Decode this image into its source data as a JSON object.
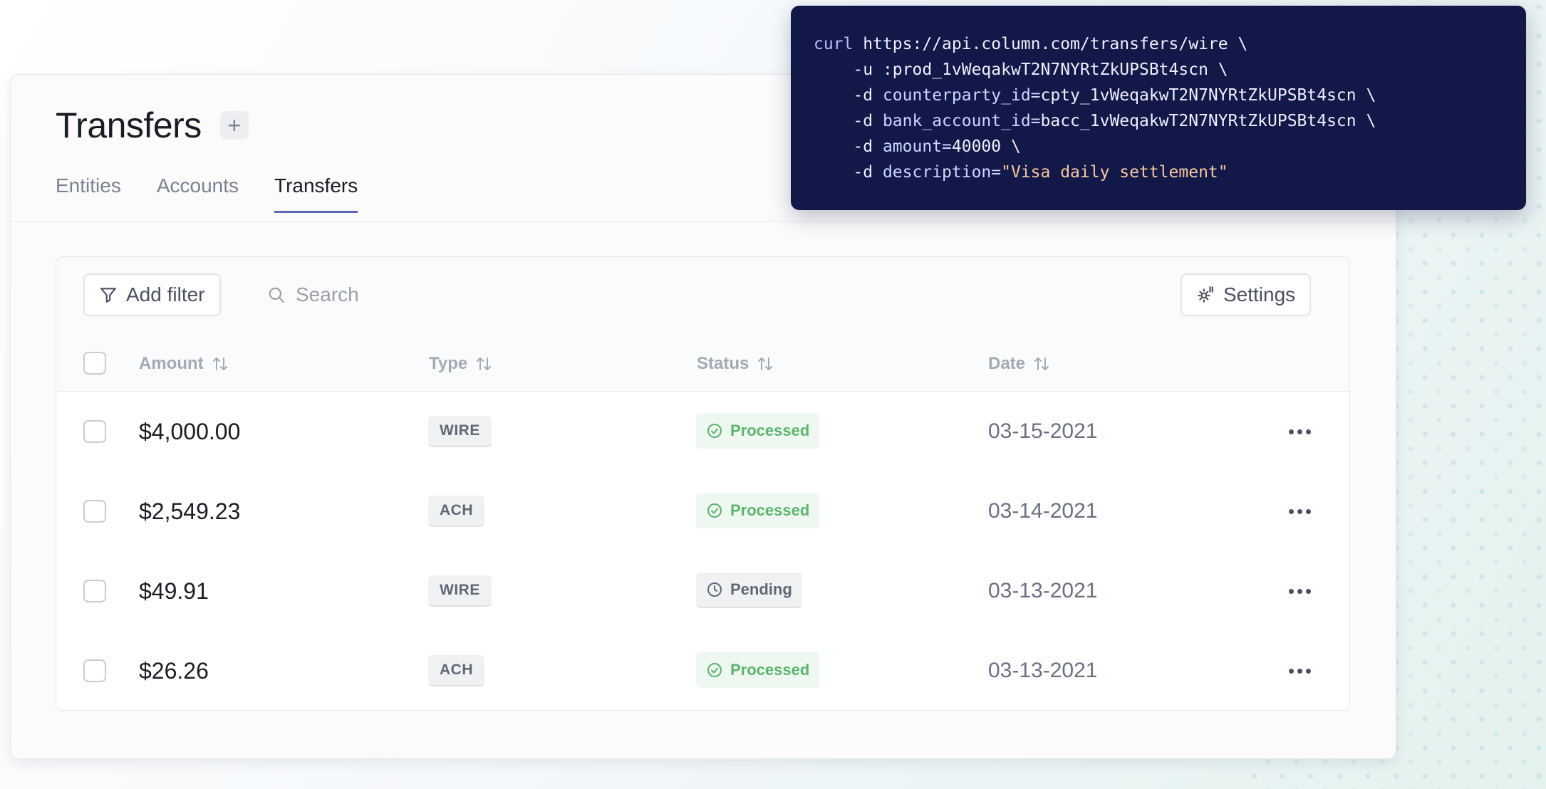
{
  "page": {
    "title": "Transfers",
    "add_label": "+",
    "tabs": [
      {
        "label": "Entities",
        "active": false
      },
      {
        "label": "Accounts",
        "active": false
      },
      {
        "label": "Transfers",
        "active": true
      }
    ]
  },
  "toolbar": {
    "add_filter_label": "Add filter",
    "search_placeholder": "Search",
    "settings_label": "Settings"
  },
  "table": {
    "columns": [
      "Amount",
      "Type",
      "Status",
      "Date"
    ],
    "rows": [
      {
        "amount": "$4,000.00",
        "type": "WIRE",
        "status": "Processed",
        "status_kind": "ok",
        "date": "03-15-2021"
      },
      {
        "amount": "$2,549.23",
        "type": "ACH",
        "status": "Processed",
        "status_kind": "ok",
        "date": "03-14-2021"
      },
      {
        "amount": "$49.91",
        "type": "WIRE",
        "status": "Pending",
        "status_kind": "pending",
        "date": "03-13-2021"
      },
      {
        "amount": "$26.26",
        "type": "ACH",
        "status": "Processed",
        "status_kind": "ok",
        "date": "03-13-2021"
      }
    ]
  },
  "code": {
    "command": "curl",
    "url": "https://api.column.com/transfers/wire \\",
    "lines": [
      {
        "flag": "-u",
        "key": "",
        "value": ":prod_1vWeqakwT2N7NYRtZkUPSBt4scn \\",
        "value_kind": "plain"
      },
      {
        "flag": "-d",
        "key": "counterparty_id=",
        "value": "cpty_1vWeqakwT2N7NYRtZkUPSBt4scn \\",
        "value_kind": "plain"
      },
      {
        "flag": "-d",
        "key": "bank_account_id=",
        "value": "bacc_1vWeqakwT2N7NYRtZkUPSBt4scn \\",
        "value_kind": "plain"
      },
      {
        "flag": "-d",
        "key": "amount=",
        "value": "40000 \\",
        "value_kind": "plain"
      },
      {
        "flag": "-d",
        "key": "description=",
        "value": "\"Visa daily settlement\"",
        "value_kind": "string"
      }
    ]
  },
  "colors": {
    "accent": "#5b6bb0",
    "code_bg": "#121848",
    "success": "#5cb46e"
  }
}
